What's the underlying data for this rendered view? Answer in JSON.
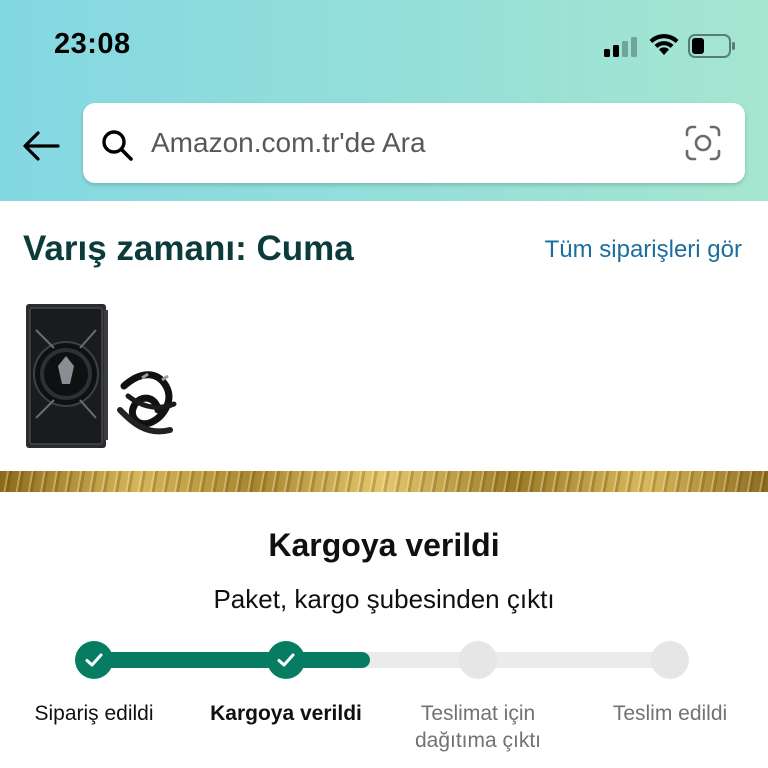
{
  "status_bar": {
    "time": "23:08",
    "signal_bars_filled": 2,
    "signal_bars_total": 4,
    "battery_level": 0.3
  },
  "search": {
    "placeholder": "Amazon.com.tr'de Ara",
    "icons": [
      "back-arrow-icon",
      "search-icon",
      "camera-scan-icon"
    ]
  },
  "order": {
    "arrival_text": "Varış zamanı: Cuma",
    "all_orders_link": "Tüm siparişleri gör",
    "product_image": "power-supply-unit"
  },
  "tracking": {
    "title": "Kargoya verildi",
    "subtitle": "Paket, kargo şubesinden çıktı",
    "progress": 0.48,
    "steps": [
      {
        "label": "Sipariş edildi",
        "state": "done"
      },
      {
        "label": "Kargoya verildi",
        "state": "current"
      },
      {
        "label": "Teslimat için dağıtıma çıktı",
        "state": "pending"
      },
      {
        "label": "Teslim edildi",
        "state": "pending"
      }
    ]
  },
  "colors": {
    "header_gradient_start": "#84d8e3",
    "header_gradient_end": "#a5e6d0",
    "accent_green": "#067d62",
    "link_blue": "#1c6f9c",
    "arrival_text": "#0c3b3c"
  }
}
